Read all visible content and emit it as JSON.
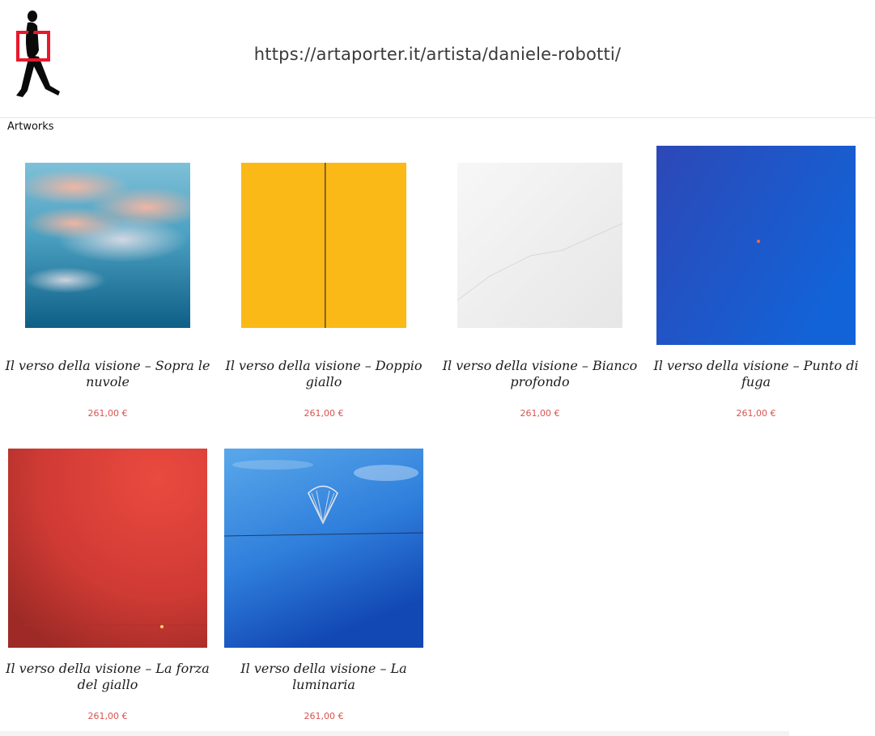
{
  "header": {
    "url": "https://artaporter.it/artista/daniele-robotti/",
    "logo_icon": "walking-man-with-frame-icon"
  },
  "section": {
    "title": "Artworks"
  },
  "colors": {
    "price": "#d9534f",
    "logo_frame": "#e8192c"
  },
  "artworks": [
    {
      "title": "Il verso della visione – Sopra le nuvole",
      "price": "261,00 €",
      "image": "clouds-sky-image"
    },
    {
      "title": "Il verso della visione – Doppio giallo",
      "price": "261,00 €",
      "image": "yellow-split-image"
    },
    {
      "title": "Il verso della visione – Bianco profondo",
      "price": "261,00 €",
      "image": "white-image"
    },
    {
      "title": "Il verso della visione – Punto di fuga",
      "price": "261,00 €",
      "image": "blue-point-image"
    },
    {
      "title": "Il verso della visione – La forza del giallo",
      "price": "261,00 €",
      "image": "red-room-image"
    },
    {
      "title": "Il verso della visione – La luminaria",
      "price": "261,00 €",
      "image": "blue-luminaria-image"
    }
  ]
}
